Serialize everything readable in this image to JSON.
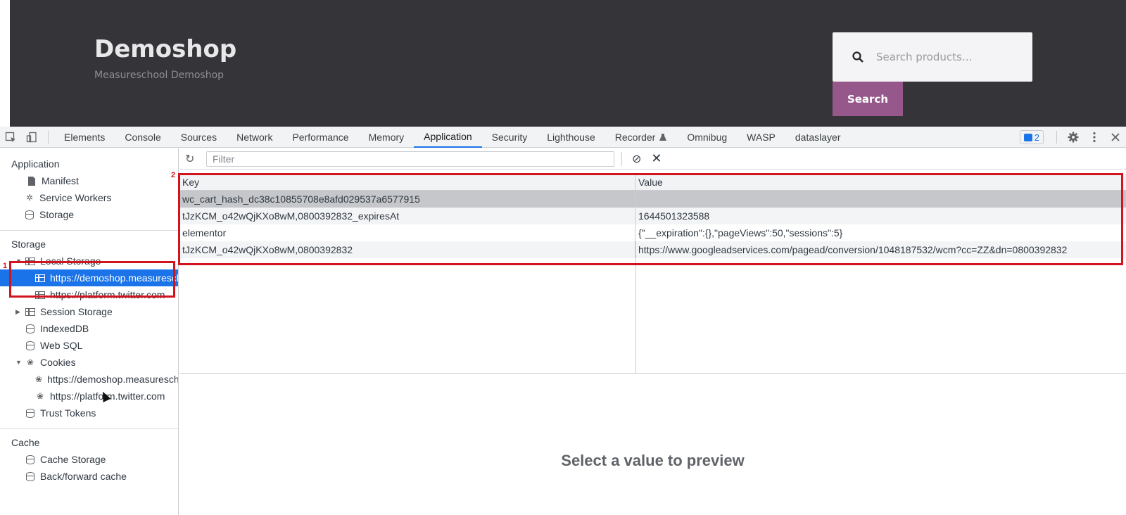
{
  "site": {
    "title": "Demoshop",
    "subtitle": "Measureschool Demoshop",
    "search_placeholder": "Search products…",
    "search_button": "Search"
  },
  "devtools": {
    "tabs": [
      {
        "label": "Elements",
        "active": false
      },
      {
        "label": "Console",
        "active": false
      },
      {
        "label": "Sources",
        "active": false
      },
      {
        "label": "Network",
        "active": false
      },
      {
        "label": "Performance",
        "active": false
      },
      {
        "label": "Memory",
        "active": false
      },
      {
        "label": "Application",
        "active": true
      },
      {
        "label": "Security",
        "active": false
      },
      {
        "label": "Lighthouse",
        "active": false
      },
      {
        "label": "Recorder",
        "active": false
      },
      {
        "label": "Omnibug",
        "active": false
      },
      {
        "label": "WASP",
        "active": false
      },
      {
        "label": "dataslayer",
        "active": false
      }
    ],
    "messages_count": "2",
    "accent_color": "#1a73e8"
  },
  "sidebar": {
    "application_header": "Application",
    "application_items": [
      "Manifest",
      "Service Workers",
      "Storage"
    ],
    "storage_header": "Storage",
    "local_storage": "Local Storage",
    "local_storage_origins": [
      "https://demoshop.measureschool.com",
      "https://platform.twitter.com"
    ],
    "session_storage": "Session Storage",
    "indexeddb": "IndexedDB",
    "websql": "Web SQL",
    "cookies": "Cookies",
    "cookie_origins": [
      "https://demoshop.measureschool.com",
      "https://platform.twitter.com"
    ],
    "trust_tokens": "Trust Tokens",
    "cache_header": "Cache",
    "cache_items": [
      "Cache Storage",
      "Back/forward cache"
    ]
  },
  "annotations": {
    "label_1": "1",
    "label_2": "2",
    "color": "#d2141e"
  },
  "main": {
    "filter_placeholder": "Filter",
    "table": {
      "columns": [
        "Key",
        "Value"
      ],
      "rows": [
        {
          "key": "wc_cart_hash_dc38c10855708e8afd029537a6577915",
          "value": ""
        },
        {
          "key": "tJzKCM_o42wQjKXo8wM,0800392832_expiresAt",
          "value": "1644501323588"
        },
        {
          "key": "elementor",
          "value": "{\"__expiration\":{},\"pageViews\":50,\"sessions\":5}"
        },
        {
          "key": "tJzKCM_o42wQjKXo8wM,0800392832",
          "value": "https://www.googleadservices.com/pagead/conversion/1048187532/wcm?cc=ZZ&dn=0800392832"
        }
      ]
    },
    "preview_text": "Select a value to preview"
  }
}
